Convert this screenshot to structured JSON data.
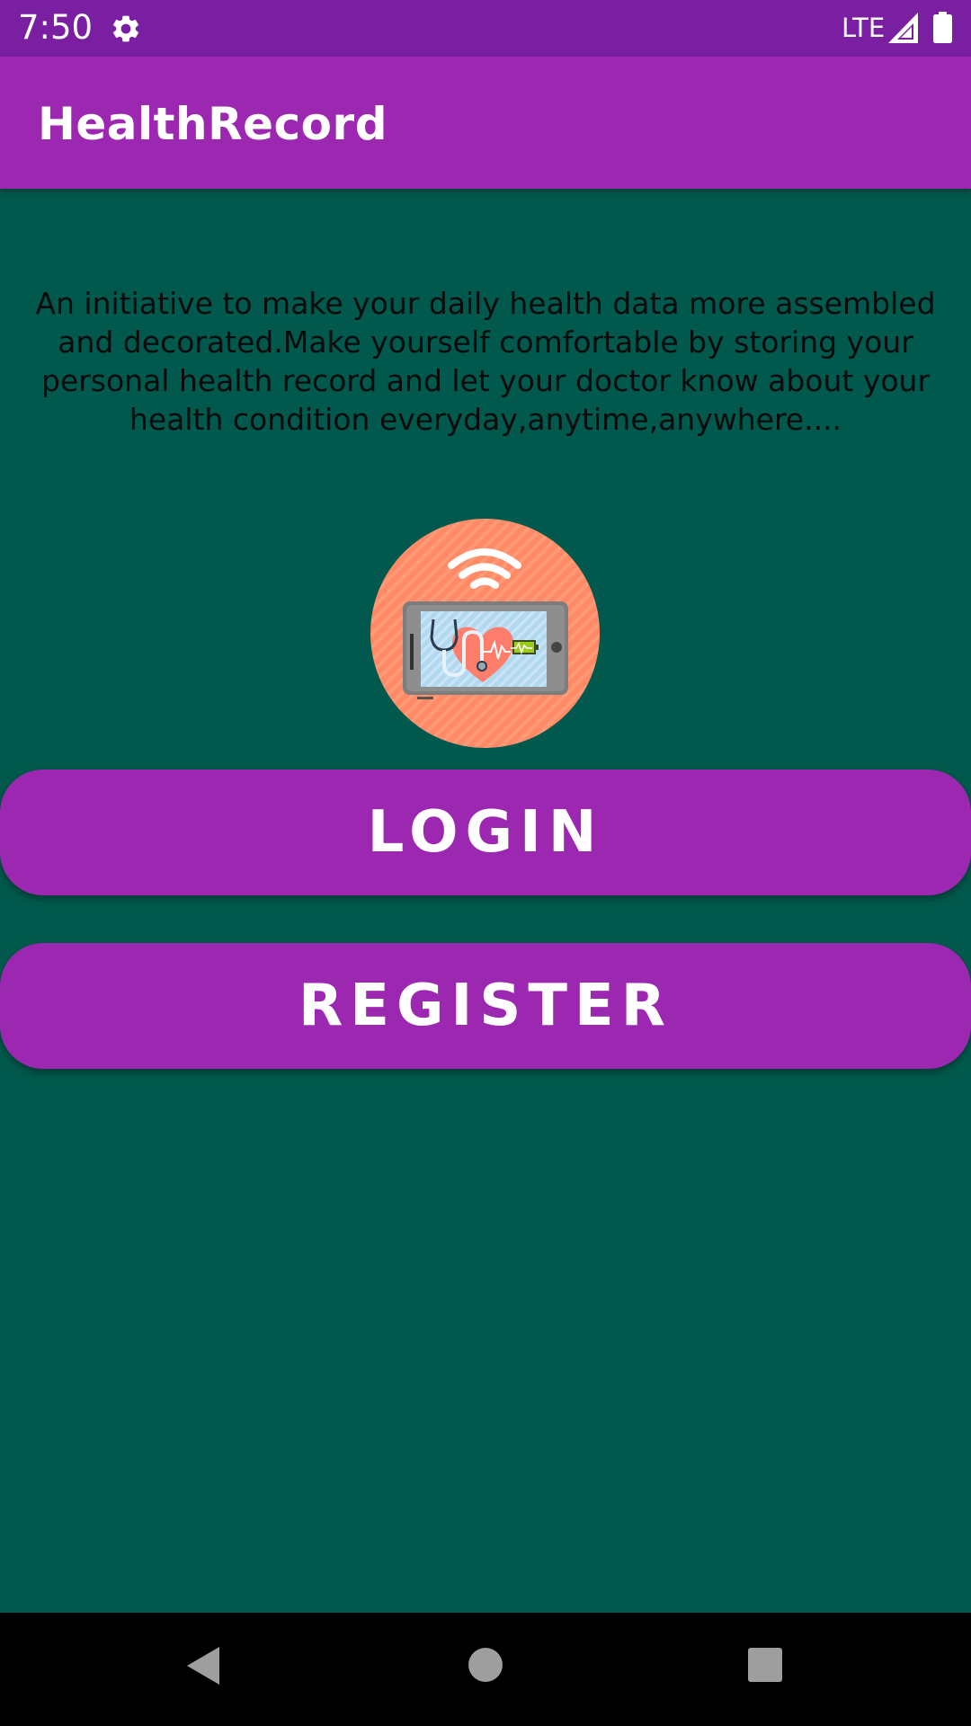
{
  "status_bar": {
    "time": "7:50",
    "network": "LTE",
    "icons": [
      "gear-icon",
      "signal-icon",
      "battery-icon"
    ]
  },
  "app_bar": {
    "title": "HealthRecord"
  },
  "main": {
    "intro_text": "An initiative to make your daily health data more assembled and decorated.Make yourself comfortable by storing your personal health record and let your doctor know about your health condition everyday,anytime,anywhere....",
    "logo_icon": "health-monitor-icon",
    "login_label": "LOGIN",
    "register_label": "REGISTER"
  },
  "nav_bar": {
    "icons": [
      "back-icon",
      "home-icon",
      "recents-icon"
    ]
  },
  "colors": {
    "status_bar": "#7b1fa2",
    "app_bar": "#9c27b0",
    "background": "#00594c",
    "button": "#9c27b0",
    "logo_circle": "#ff8a65"
  }
}
